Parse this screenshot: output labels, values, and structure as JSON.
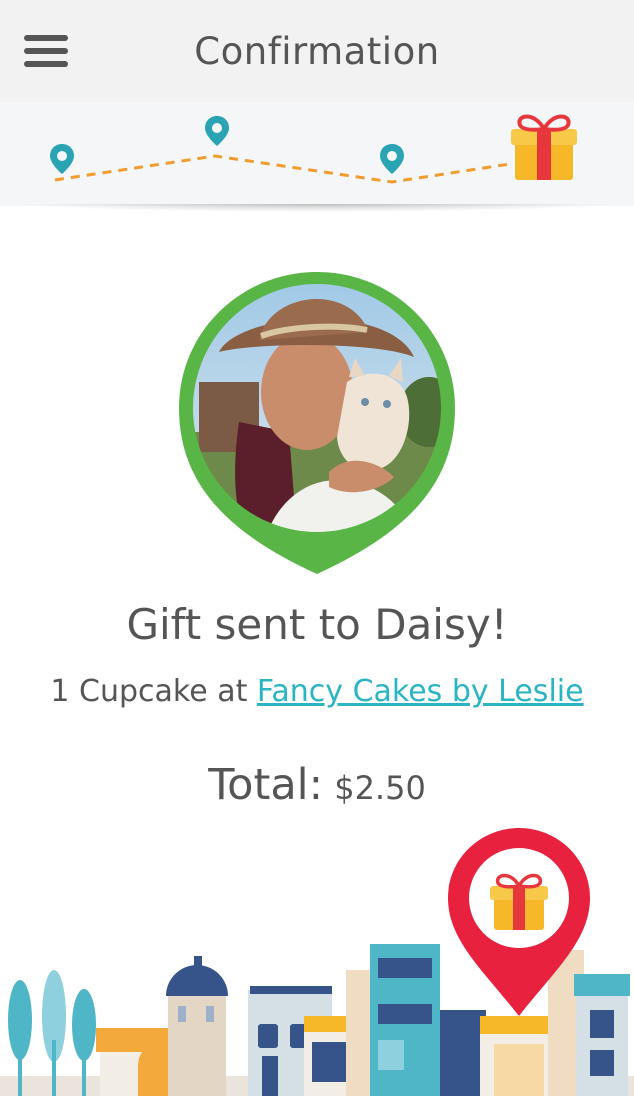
{
  "header": {
    "title": "Confirmation",
    "menu_icon": "hamburger-menu-icon"
  },
  "progress": {
    "steps": [
      "location-pin-icon",
      "location-pin-icon",
      "location-pin-icon",
      "gift-icon"
    ],
    "colors": {
      "pin": "#2aa3b3",
      "dash": "#f29b2e",
      "gift_box": "#f6b829",
      "gift_ribbon": "#e8373c"
    }
  },
  "recipient": {
    "photo_icon": "recipient-photo",
    "ring_color": "#59b646"
  },
  "message": {
    "headline": "Gift sent to Daisy!",
    "item_prefix": "1 Cupcake at ",
    "merchant_link": "Fancy Cakes by Leslie"
  },
  "total": {
    "label": "Total:",
    "amount": "$2.50"
  },
  "illustration": {
    "pin_color": "#e8213f",
    "name": "city-skyline-illustration"
  }
}
